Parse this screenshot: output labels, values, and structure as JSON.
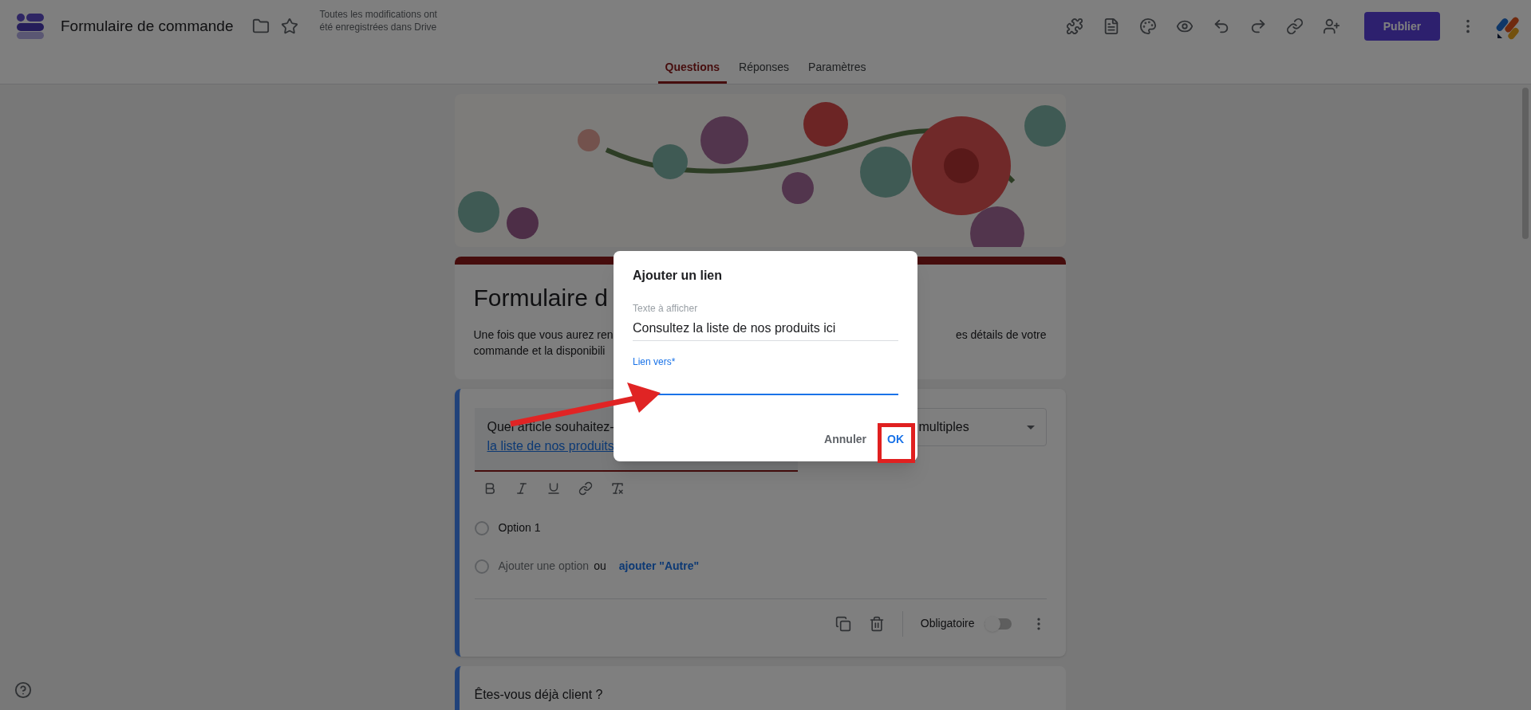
{
  "app": {
    "title": "Formulaire de commande",
    "save_status": "Toutes les modifications ont été enregistrées dans Drive",
    "publish_button": "Publier"
  },
  "tabs": [
    {
      "label": "Questions",
      "selected": true
    },
    {
      "label": "Réponses",
      "selected": false
    },
    {
      "label": "Paramètres",
      "selected": false
    }
  ],
  "form_header": {
    "title": "Formulaire d",
    "description_left": [
      "Une fois que vous aurez ren",
      "commande et la disponibili"
    ],
    "description_right": "es détails de votre"
  },
  "question_card": {
    "text": "Quel article souhaitez-",
    "link": "la liste de nos produits",
    "type_dropdown": "multiples",
    "options": [
      {
        "label": "Option 1"
      }
    ],
    "add_option": "Ajouter une option",
    "or": "ou",
    "add_other": "ajouter \"Autre\"",
    "required_label": "Obligatoire",
    "required": false
  },
  "next_question": {
    "text": "Êtes-vous déjà client ?"
  },
  "dialog": {
    "title": "Ajouter un lien",
    "fields": [
      {
        "label": "Texte à afficher",
        "value": "Consultez la liste de nos produits ici",
        "focused": false
      },
      {
        "label": "Lien vers*",
        "focused": true
      }
    ],
    "cancel": "Annuler",
    "ok": "OK"
  }
}
